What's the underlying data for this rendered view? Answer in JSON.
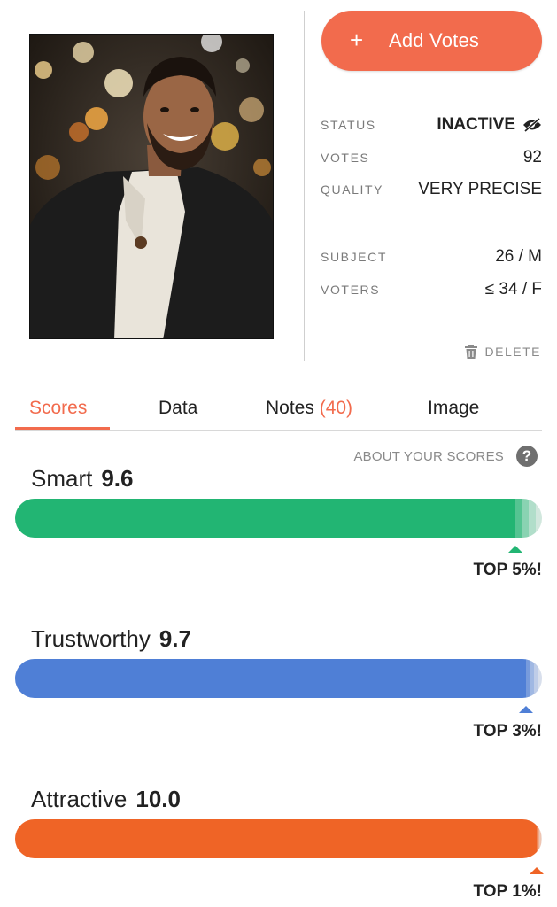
{
  "header": {
    "add_votes_label": "Add Votes",
    "add_votes_icon": "plus-icon"
  },
  "info": {
    "status_label": "STATUS",
    "status_value": "INACTIVE",
    "status_icon": "eye-off-icon",
    "votes_label": "VOTES",
    "votes_value": "92",
    "quality_label": "QUALITY",
    "quality_value": "VERY PRECISE",
    "subject_label": "SUBJECT",
    "subject_value": "26 / M",
    "voters_label": "VOTERS",
    "voters_value": "≤ 34 / F"
  },
  "delete_label": "DELETE",
  "tabs": [
    {
      "label": "Scores",
      "active": true
    },
    {
      "label": "Data",
      "active": false
    },
    {
      "label": "Notes",
      "count": "(40)",
      "active": false
    },
    {
      "label": "Image",
      "active": false
    }
  ],
  "about_label": "ABOUT YOUR SCORES",
  "metrics": [
    {
      "name": "Smart",
      "score": "9.6",
      "top": "TOP 5%!",
      "color": "#22b573",
      "percentile": 0.95
    },
    {
      "name": "Trustworthy",
      "score": "9.7",
      "top": "TOP 3%!",
      "color": "#4f7fd6",
      "percentile": 0.97
    },
    {
      "name": "Attractive",
      "score": "10.0",
      "top": "TOP 1%!",
      "color": "#ef6426",
      "percentile": 0.99
    }
  ]
}
